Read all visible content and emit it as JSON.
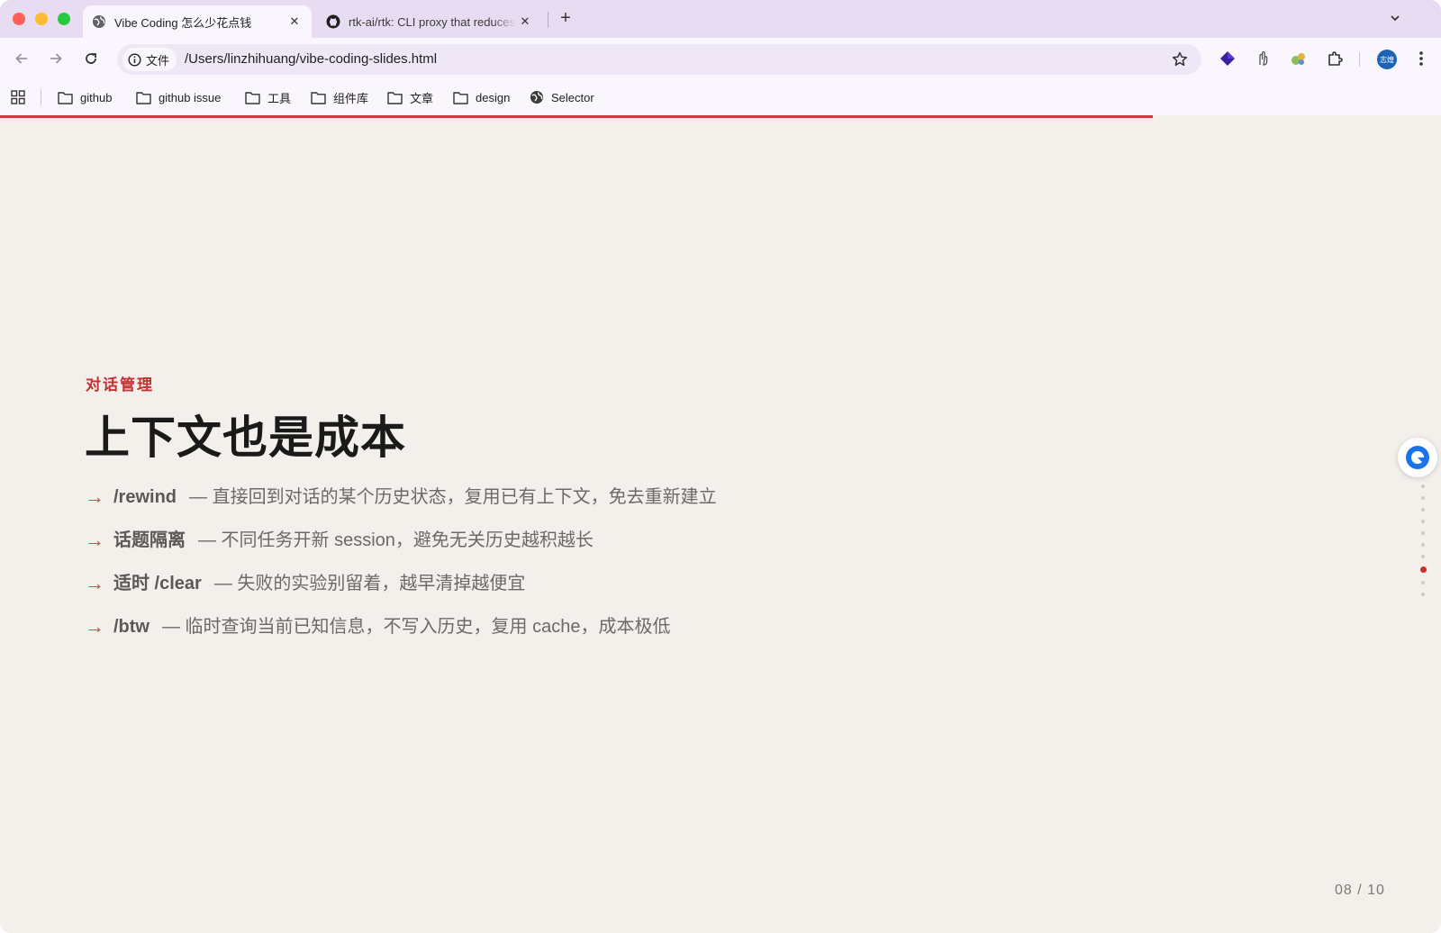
{
  "tabs": [
    {
      "title": "Vibe Coding 怎么少花点钱",
      "active": true,
      "favicon": "globe-icon"
    },
    {
      "title": "rtk-ai/rtk: CLI proxy that reduces",
      "active": false,
      "favicon": "github-icon"
    }
  ],
  "toolbar": {
    "security_chip": "文件",
    "url": "/Users/linzhihuang/vibe-coding-slides.html",
    "avatar_text": "志煌"
  },
  "bookmarks": [
    {
      "label": "github",
      "icon": "folder-icon"
    },
    {
      "label": "github issue",
      "icon": "folder-icon"
    },
    {
      "label": "工具",
      "icon": "folder-icon"
    },
    {
      "label": "组件库",
      "icon": "folder-icon"
    },
    {
      "label": "文章",
      "icon": "folder-icon"
    },
    {
      "label": "design",
      "icon": "folder-icon"
    },
    {
      "label": "Selector",
      "icon": "globe-icon"
    }
  ],
  "slide": {
    "eyebrow": "对话管理",
    "title": "上下文也是成本",
    "arrow": "→",
    "bullets": [
      {
        "key": "/rewind",
        "desc": "— 直接回到对话的某个历史状态，复用已有上下文，免去重新建立"
      },
      {
        "key": "话题隔离",
        "desc": "— 不同任务开新 session，避免无关历史越积越长"
      },
      {
        "key": "适时 /clear",
        "desc": "— 失败的实验别留着，越早清掉越便宜"
      },
      {
        "key": "/btw",
        "desc": "— 临时查询当前已知信息，不写入历史，复用 cache，成本极低"
      }
    ],
    "counter": "08 / 10",
    "current_slide": 8,
    "total_slides": 10
  },
  "colors": {
    "accent": "#c62f2f",
    "background": "#f3f0eb",
    "tabstrip": "#e7dcf2",
    "toolbar": "#faf6fd"
  }
}
